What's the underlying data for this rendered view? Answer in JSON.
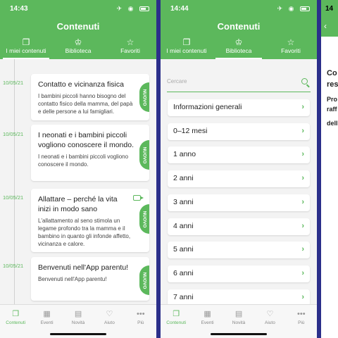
{
  "colors": {
    "accent": "#5cb85c",
    "divider": "#2b2f8a"
  },
  "screen1": {
    "time": "14:43",
    "title": "Contenuti",
    "tabs": [
      {
        "label": "I miei contenuti",
        "icon": "book-icon"
      },
      {
        "label": "Biblioteca",
        "icon": "graduation-cap-icon"
      },
      {
        "label": "Favoriti",
        "icon": "star-icon"
      }
    ],
    "cards": [
      {
        "date": "10/05/21",
        "title": "Contatto e vicinanza fisica",
        "text": "I bambini piccoli hanno bisogno del contatto fisico della mamma, del papà e delle persone a lui famigliari.",
        "badge": "NUOVO"
      },
      {
        "date": "10/05/21",
        "title": "I neonati e i bambini piccoli vogliono conoscere il mondo.",
        "text": "I neonati e i bambini piccoli vogliono conoscere il mondo.",
        "badge": "NUOVO"
      },
      {
        "date": "10/05/21",
        "title": "Allattare  –  perché la vita inizi in modo sano",
        "text": "L'allattamento al seno stimola un legame profondo tra la mamma e il bambino in quanto gli infonde affetto, vicinanza e calore.",
        "badge": "NUOVO",
        "icon": "video-icon"
      },
      {
        "date": "10/05/21",
        "title": "Benvenuti nell'App parentu!",
        "text": "Benvenuti nell'App parentu!",
        "badge": "NUOVO"
      }
    ]
  },
  "screen2": {
    "time": "14:44",
    "title": "Contenuti",
    "search_placeholder": "Cercare",
    "items": [
      "Informazioni generali",
      "0–12 mesi",
      "1 anno",
      "2 anni",
      "3 anni",
      "4 anni",
      "5 anni",
      "6 anni",
      "7 anni"
    ]
  },
  "screen3": {
    "time": "14",
    "lines": [
      "Co",
      "res",
      "Pro",
      "raff",
      "dell"
    ]
  },
  "bottom_nav": [
    {
      "label": "Contenuti",
      "icon": "documents-icon"
    },
    {
      "label": "Eventi",
      "icon": "calendar-icon"
    },
    {
      "label": "Novità",
      "icon": "newspaper-icon"
    },
    {
      "label": "Aiuto",
      "icon": "handshake-icon"
    },
    {
      "label": "Più",
      "icon": "more-dots-icon"
    }
  ]
}
